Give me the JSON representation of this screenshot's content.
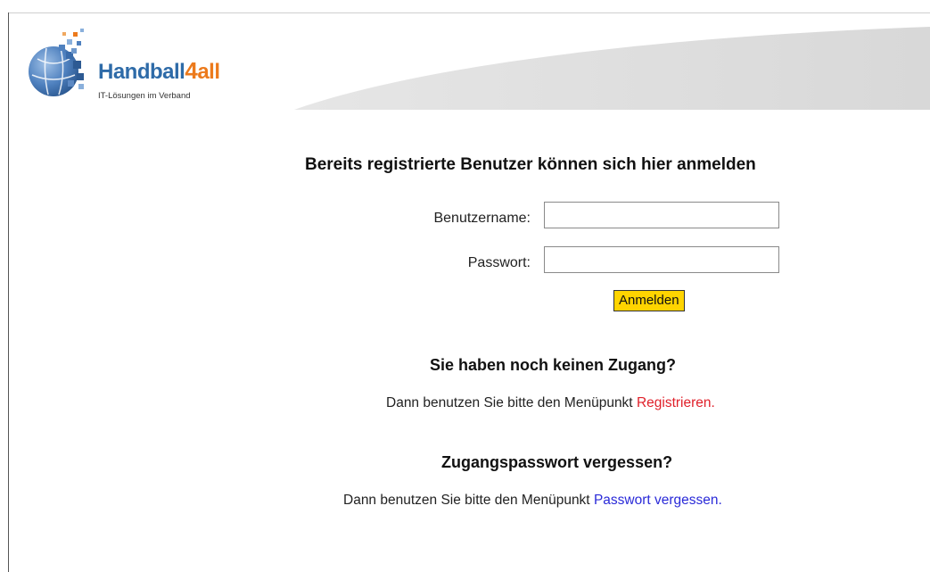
{
  "logo": {
    "brand_main": "Handball",
    "brand_num": "4",
    "brand_suffix": "all",
    "tagline": "IT-Lösungen im Verband"
  },
  "login": {
    "heading": "Bereits registrierte Benutzer können sich hier anmelden",
    "username_label": "Benutzername:",
    "username_value": "",
    "password_label": "Passwort:",
    "password_value": "",
    "submit_label": "Anmelden"
  },
  "register": {
    "heading": "Sie haben noch keinen Zugang?",
    "text_prefix": "Dann benutzen Sie bitte den Menüpunkt ",
    "link_label": "Registrieren",
    "text_suffix": "."
  },
  "forgot": {
    "heading": "Zugangspasswort vergessen?",
    "text_prefix": "Dann benutzen Sie bitte den Menüpunkt ",
    "link_label": "Passwort vergessen",
    "text_suffix": "."
  },
  "colors": {
    "brand_blue": "#2e6ba8",
    "brand_orange": "#ec7a1c",
    "button_yellow": "#ffd400",
    "link_red": "#e0202a",
    "link_blue": "#2a2ad8"
  }
}
